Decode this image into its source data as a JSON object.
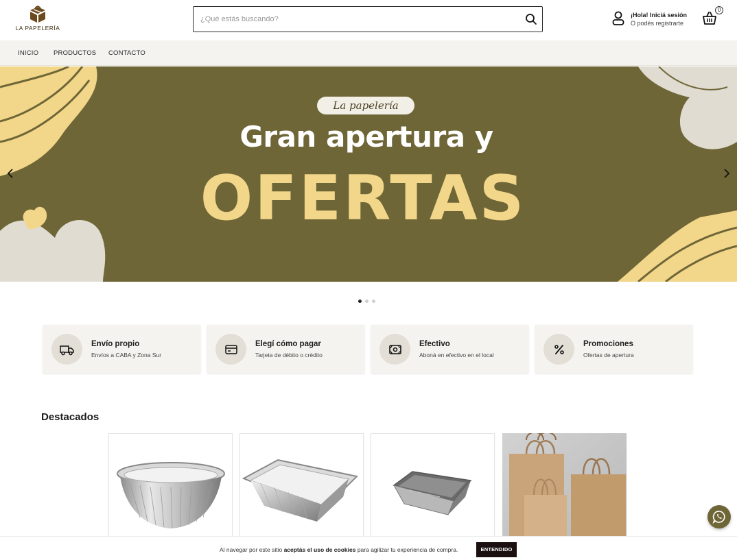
{
  "header": {
    "logo_text": "LA PAPELERÍA",
    "search_placeholder": "¿Qué estás buscando?",
    "account_greeting": "¡Hola! Iniciá sesión",
    "account_register": "O podés registrarte",
    "cart_count": "0"
  },
  "nav": {
    "items": [
      {
        "label": "INICIO"
      },
      {
        "label": "PRODUCTOS"
      },
      {
        "label": "CONTACTO"
      }
    ]
  },
  "banner": {
    "tag": "La papelería",
    "line1": "Gran apertura y",
    "line2": "OFERTAS",
    "slide_count": 3,
    "active_slide": 1
  },
  "features": [
    {
      "title": "Envío propio",
      "subtitle": "Envíos a CABA y Zona Sur",
      "icon": "truck-icon"
    },
    {
      "title": "Elegí cómo pagar",
      "subtitle": "Tarjeta de débito o crédito",
      "icon": "credit-card-icon"
    },
    {
      "title": "Efectivo",
      "subtitle": "Aboná en efectivo en el local",
      "icon": "cash-icon"
    },
    {
      "title": "Promociones",
      "subtitle": "Ofertas de apertura",
      "icon": "percent-icon"
    }
  ],
  "featured": {
    "title": "Destacados",
    "products": [
      {
        "image": "round-aluminum-tray"
      },
      {
        "image": "rectangular-aluminum-tray"
      },
      {
        "image": "small-rectangular-tray"
      },
      {
        "image": "kraft-paper-bags"
      }
    ]
  },
  "cookie": {
    "text_before": "Al navegar por este sitio ",
    "text_bold": "aceptás el uso de cookies",
    "text_after": " para agilizar tu experiencia de compra.",
    "button": "ENTENDIDO"
  },
  "colors": {
    "olive": "#6f6637",
    "cream": "#f2d68a",
    "beige": "#e0dcd2",
    "nav_bg": "#f5f3ef"
  }
}
